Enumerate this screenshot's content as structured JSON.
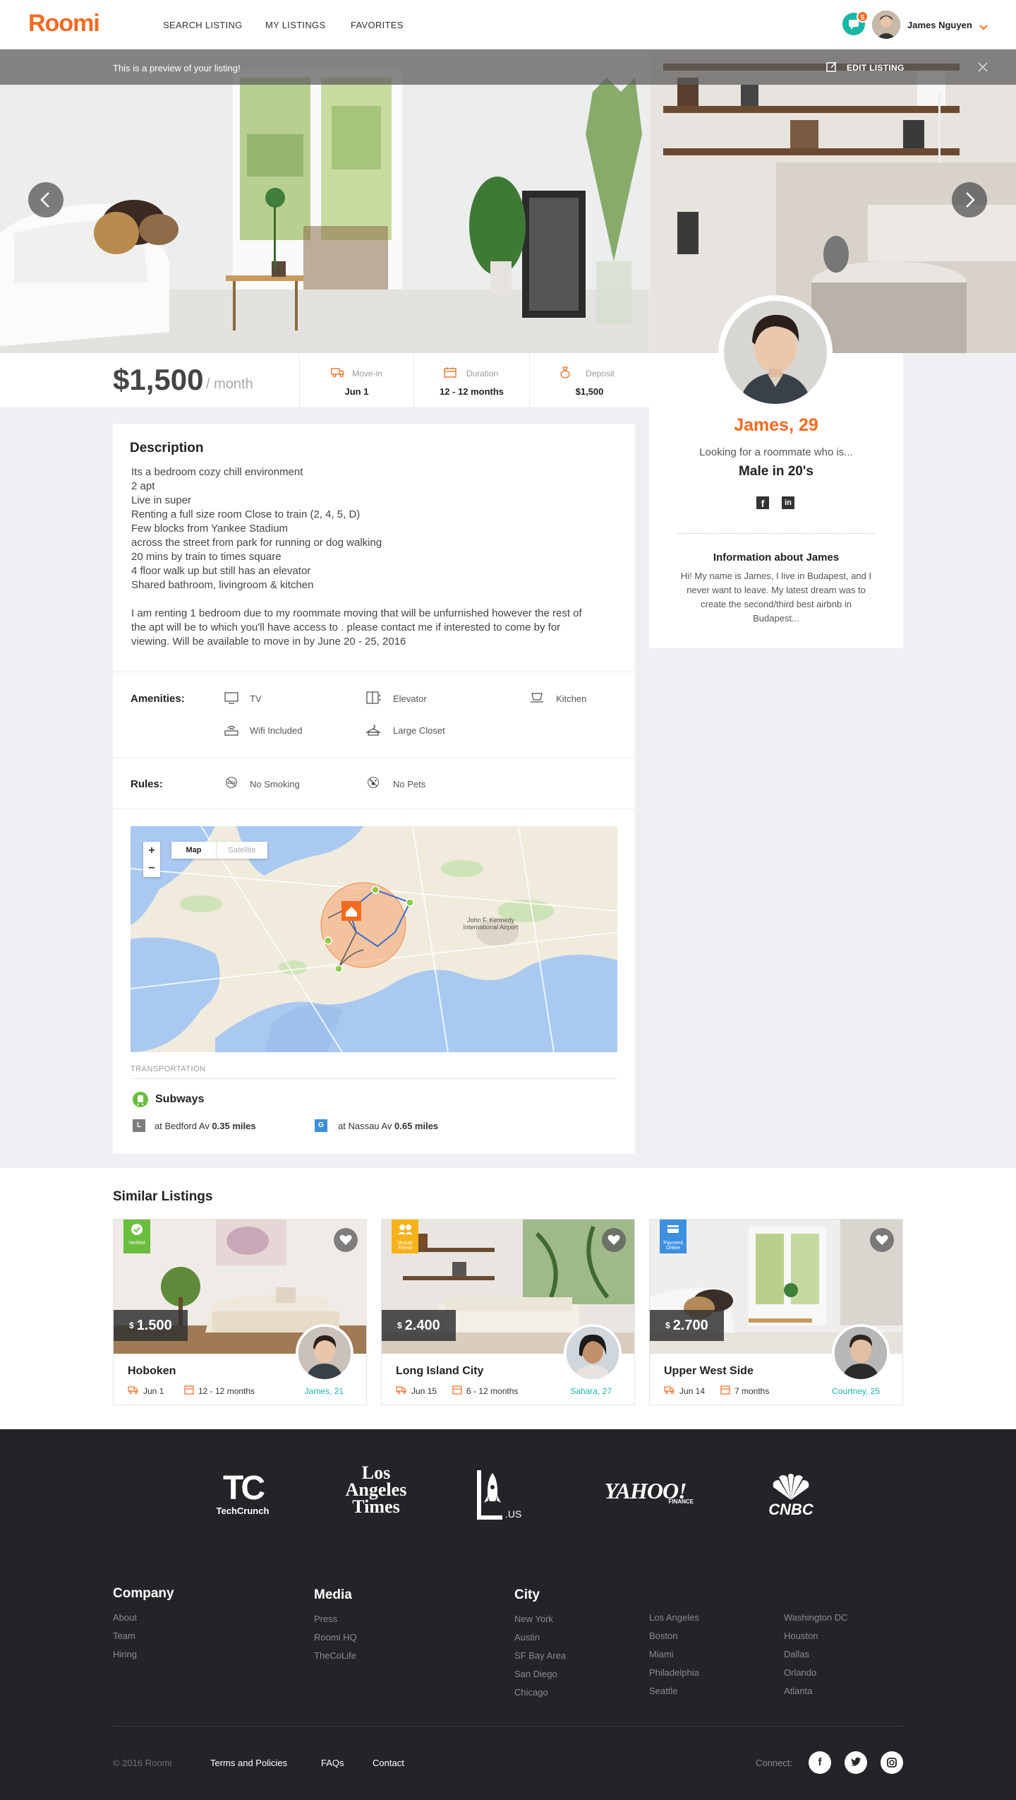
{
  "header": {
    "logo": "Roomi",
    "nav": [
      "SEARCH LISTING",
      "MY LISTINGS",
      "FAVORITES"
    ],
    "chat_badge": "5",
    "user_name": "James Nguyen"
  },
  "preview": {
    "text": "This is a preview of your listing!",
    "edit_label": "EDIT LISTING"
  },
  "listing": {
    "price": "$1,500",
    "per": "/ month",
    "stats": [
      {
        "label": "Move-in",
        "value": "Jun 1"
      },
      {
        "label": "Duration",
        "value": "12 - 12 months"
      },
      {
        "label": "Deposit",
        "value": "$1,500"
      }
    ]
  },
  "profile": {
    "name": "James, 29",
    "looking": "Looking for a roommate who is...",
    "wants": "Male in 20's",
    "info_title": "Information about James",
    "about": "Hi! My name is James, I live in Budapest, and I never want to leave. My latest dream was to create the second/third best airbnb in Budapest..."
  },
  "description": {
    "title": "Description",
    "lines": [
      "Its a bedroom cozy chill environment",
      "2 apt",
      "Live in super",
      "Renting a full size room Close to train (2, 4, 5, D)",
      "Few blocks from Yankee Stadium",
      "across the street from park for running or dog walking",
      "20 mins by train to times square",
      "4 floor walk up but still has an elevator",
      "Shared bathroom, livingroom & kitchen"
    ],
    "paragraph": [
      "I am renting 1 bedroom due to my roommate moving that will be unfurnished however the rest of",
      "the apt will be to which you'll have access to . please contact me if interested to come by for",
      "viewing. Will be available to move in by June 20 - 25, 2016"
    ]
  },
  "amenities": {
    "label": "Amenities:",
    "items": [
      "TV",
      "Elevator",
      "Kitchen",
      "Wifi Included",
      "Large Closet"
    ]
  },
  "rules": {
    "label": "Rules:",
    "items": [
      "No Smoking",
      "No Pets"
    ]
  },
  "map": {
    "zoom_in": "+",
    "zoom_out": "−",
    "type_map": "Map",
    "type_satellite": "Satellite",
    "airport_label": "John F. Kennedy International Airport"
  },
  "transportation": {
    "label": "TRANSPORTATION",
    "title": "Subways",
    "stations": [
      {
        "line": "L",
        "color": "#7d7d7d",
        "text": "at Bedford Av",
        "dist": "0.35 miles"
      },
      {
        "line": "G",
        "color": "#3d8fe0",
        "text": "at Nassau Av",
        "dist": "0.65 miles"
      }
    ]
  },
  "similar": {
    "title": "Similar Listings",
    "items": [
      {
        "price": "1.500",
        "currency": "$",
        "name": "Hoboken",
        "movein": "Jun 1",
        "duration": "12 - 12 months",
        "who": "James, 21",
        "badge": "Verified",
        "badge_color": "#6bbd3e"
      },
      {
        "price": "2.400",
        "currency": "$",
        "name": "Long Island City",
        "movein": "Jun 15",
        "duration": "6 - 12 months",
        "who": "Sahara, 27",
        "badge": "Mutual Friend",
        "badge_color": "#f5b21a"
      },
      {
        "price": "2.700",
        "currency": "$",
        "name": "Upper West Side",
        "movein": "Jun 14",
        "duration": "7 months",
        "who": "Courtney, 25",
        "badge": "Payment Online",
        "badge_color": "#3d8fe0"
      }
    ]
  },
  "press": {
    "techcrunch": "TechCrunch",
    "tc_mark": "TC",
    "lat_line1": "Los",
    "lat_line2": "Angeles",
    "lat_line3": "Times",
    "la_mark": "LA",
    "la_suffix": ".US",
    "yahoo": "YAHOO!",
    "yahoo_sub": "FINANCE",
    "cnbc": "CNBC"
  },
  "footer": {
    "company": {
      "title": "Company",
      "links": [
        "About",
        "Team",
        "Hiring"
      ]
    },
    "media": {
      "title": "Media",
      "links": [
        "Press",
        "Roomi HQ",
        "TheCoLife"
      ]
    },
    "city": {
      "title": "City",
      "col1": [
        "New York",
        "Austin",
        "SF Bay Area",
        "San Diego",
        "Chicago"
      ],
      "col2": [
        "Los Angeles",
        "Boston",
        "Miami",
        "Philadelphia",
        "Seattle"
      ],
      "col3": [
        "Washington DC",
        "Houston",
        "Dallas",
        "Orlando",
        "Atlanta"
      ]
    },
    "copyright": "© 2016 Roomi",
    "bottom_links": [
      "Terms and Policies",
      "FAQs",
      "Contact"
    ],
    "connect": "Connect:"
  }
}
